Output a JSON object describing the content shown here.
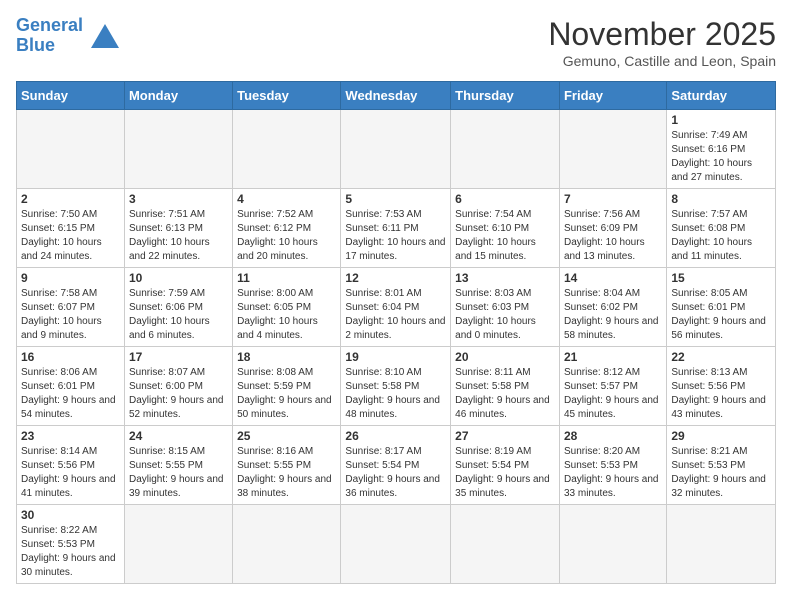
{
  "header": {
    "logo_general": "General",
    "logo_blue": "Blue",
    "month": "November 2025",
    "location": "Gemuno, Castille and Leon, Spain"
  },
  "weekdays": [
    "Sunday",
    "Monday",
    "Tuesday",
    "Wednesday",
    "Thursday",
    "Friday",
    "Saturday"
  ],
  "weeks": [
    [
      {
        "day": "",
        "info": ""
      },
      {
        "day": "",
        "info": ""
      },
      {
        "day": "",
        "info": ""
      },
      {
        "day": "",
        "info": ""
      },
      {
        "day": "",
        "info": ""
      },
      {
        "day": "",
        "info": ""
      },
      {
        "day": "1",
        "info": "Sunrise: 7:49 AM\nSunset: 6:16 PM\nDaylight: 10 hours and 27 minutes."
      }
    ],
    [
      {
        "day": "2",
        "info": "Sunrise: 7:50 AM\nSunset: 6:15 PM\nDaylight: 10 hours and 24 minutes."
      },
      {
        "day": "3",
        "info": "Sunrise: 7:51 AM\nSunset: 6:13 PM\nDaylight: 10 hours and 22 minutes."
      },
      {
        "day": "4",
        "info": "Sunrise: 7:52 AM\nSunset: 6:12 PM\nDaylight: 10 hours and 20 minutes."
      },
      {
        "day": "5",
        "info": "Sunrise: 7:53 AM\nSunset: 6:11 PM\nDaylight: 10 hours and 17 minutes."
      },
      {
        "day": "6",
        "info": "Sunrise: 7:54 AM\nSunset: 6:10 PM\nDaylight: 10 hours and 15 minutes."
      },
      {
        "day": "7",
        "info": "Sunrise: 7:56 AM\nSunset: 6:09 PM\nDaylight: 10 hours and 13 minutes."
      },
      {
        "day": "8",
        "info": "Sunrise: 7:57 AM\nSunset: 6:08 PM\nDaylight: 10 hours and 11 minutes."
      }
    ],
    [
      {
        "day": "9",
        "info": "Sunrise: 7:58 AM\nSunset: 6:07 PM\nDaylight: 10 hours and 9 minutes."
      },
      {
        "day": "10",
        "info": "Sunrise: 7:59 AM\nSunset: 6:06 PM\nDaylight: 10 hours and 6 minutes."
      },
      {
        "day": "11",
        "info": "Sunrise: 8:00 AM\nSunset: 6:05 PM\nDaylight: 10 hours and 4 minutes."
      },
      {
        "day": "12",
        "info": "Sunrise: 8:01 AM\nSunset: 6:04 PM\nDaylight: 10 hours and 2 minutes."
      },
      {
        "day": "13",
        "info": "Sunrise: 8:03 AM\nSunset: 6:03 PM\nDaylight: 10 hours and 0 minutes."
      },
      {
        "day": "14",
        "info": "Sunrise: 8:04 AM\nSunset: 6:02 PM\nDaylight: 9 hours and 58 minutes."
      },
      {
        "day": "15",
        "info": "Sunrise: 8:05 AM\nSunset: 6:01 PM\nDaylight: 9 hours and 56 minutes."
      }
    ],
    [
      {
        "day": "16",
        "info": "Sunrise: 8:06 AM\nSunset: 6:01 PM\nDaylight: 9 hours and 54 minutes."
      },
      {
        "day": "17",
        "info": "Sunrise: 8:07 AM\nSunset: 6:00 PM\nDaylight: 9 hours and 52 minutes."
      },
      {
        "day": "18",
        "info": "Sunrise: 8:08 AM\nSunset: 5:59 PM\nDaylight: 9 hours and 50 minutes."
      },
      {
        "day": "19",
        "info": "Sunrise: 8:10 AM\nSunset: 5:58 PM\nDaylight: 9 hours and 48 minutes."
      },
      {
        "day": "20",
        "info": "Sunrise: 8:11 AM\nSunset: 5:58 PM\nDaylight: 9 hours and 46 minutes."
      },
      {
        "day": "21",
        "info": "Sunrise: 8:12 AM\nSunset: 5:57 PM\nDaylight: 9 hours and 45 minutes."
      },
      {
        "day": "22",
        "info": "Sunrise: 8:13 AM\nSunset: 5:56 PM\nDaylight: 9 hours and 43 minutes."
      }
    ],
    [
      {
        "day": "23",
        "info": "Sunrise: 8:14 AM\nSunset: 5:56 PM\nDaylight: 9 hours and 41 minutes."
      },
      {
        "day": "24",
        "info": "Sunrise: 8:15 AM\nSunset: 5:55 PM\nDaylight: 9 hours and 39 minutes."
      },
      {
        "day": "25",
        "info": "Sunrise: 8:16 AM\nSunset: 5:55 PM\nDaylight: 9 hours and 38 minutes."
      },
      {
        "day": "26",
        "info": "Sunrise: 8:17 AM\nSunset: 5:54 PM\nDaylight: 9 hours and 36 minutes."
      },
      {
        "day": "27",
        "info": "Sunrise: 8:19 AM\nSunset: 5:54 PM\nDaylight: 9 hours and 35 minutes."
      },
      {
        "day": "28",
        "info": "Sunrise: 8:20 AM\nSunset: 5:53 PM\nDaylight: 9 hours and 33 minutes."
      },
      {
        "day": "29",
        "info": "Sunrise: 8:21 AM\nSunset: 5:53 PM\nDaylight: 9 hours and 32 minutes."
      }
    ],
    [
      {
        "day": "30",
        "info": "Sunrise: 8:22 AM\nSunset: 5:53 PM\nDaylight: 9 hours and 30 minutes."
      },
      {
        "day": "",
        "info": ""
      },
      {
        "day": "",
        "info": ""
      },
      {
        "day": "",
        "info": ""
      },
      {
        "day": "",
        "info": ""
      },
      {
        "day": "",
        "info": ""
      },
      {
        "day": "",
        "info": ""
      }
    ]
  ]
}
